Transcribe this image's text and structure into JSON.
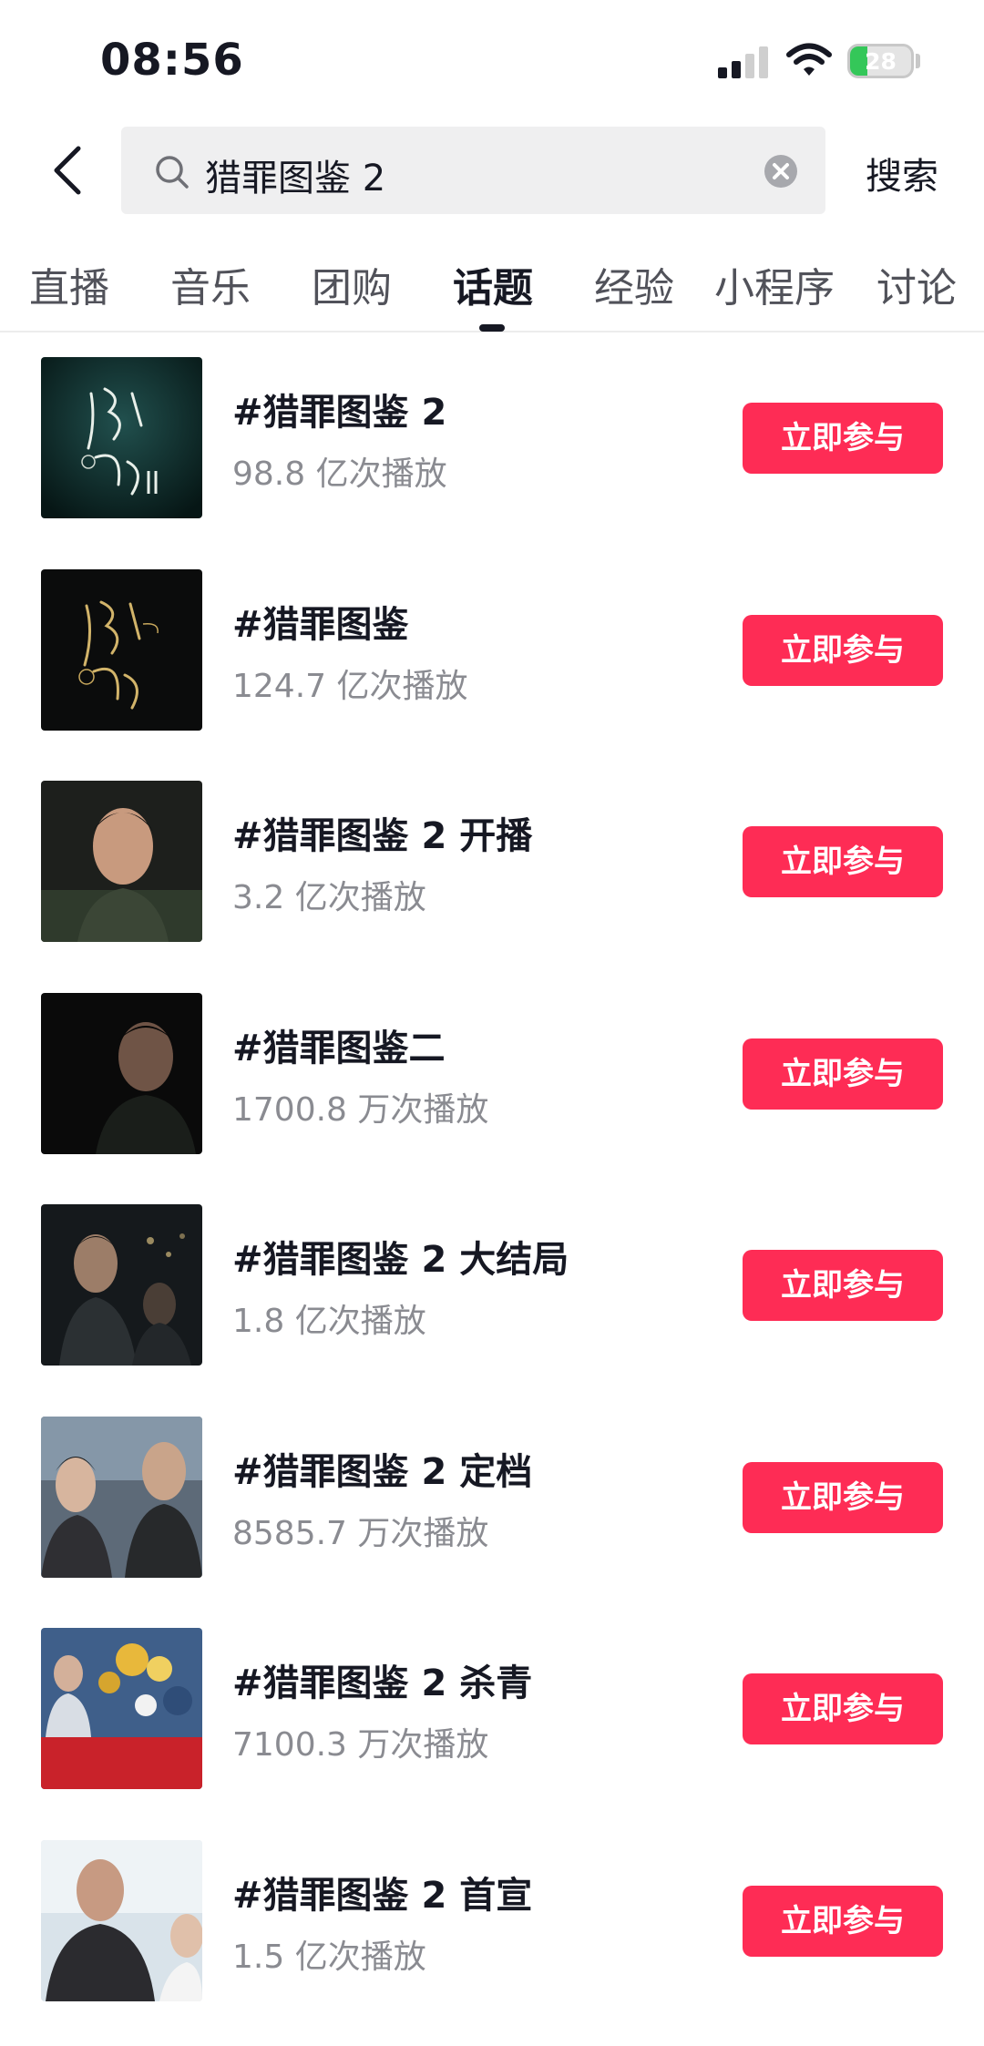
{
  "status_bar": {
    "time": "08:56",
    "battery": "28",
    "battery_level": 0.28
  },
  "search": {
    "query": "猎罪图鉴 2",
    "submit_label": "搜索"
  },
  "tabs": [
    {
      "label": "直播"
    },
    {
      "label": "音乐"
    },
    {
      "label": "团购"
    },
    {
      "label": "话题",
      "active": true
    },
    {
      "label": "经验"
    },
    {
      "label": "小程序"
    },
    {
      "label": "讨论"
    }
  ],
  "topics": [
    {
      "title": "#猎罪图鉴 2",
      "plays": "98.8 亿次播放",
      "button": "立即参与",
      "thumb": "poster-teal"
    },
    {
      "title": "#猎罪图鉴",
      "plays": "124.7 亿次播放",
      "button": "立即参与",
      "thumb": "poster-gold"
    },
    {
      "title": "#猎罪图鉴 2 开播",
      "plays": "3.2 亿次播放",
      "button": "立即参与",
      "thumb": "still-man"
    },
    {
      "title": "#猎罪图鉴二",
      "plays": "1700.8 万次播放",
      "button": "立即参与",
      "thumb": "still-dark"
    },
    {
      "title": "#猎罪图鉴 2 大结局",
      "plays": "1.8 亿次播放",
      "button": "立即参与",
      "thumb": "still-night"
    },
    {
      "title": "#猎罪图鉴 2 定档",
      "plays": "8585.7 万次播放",
      "button": "立即参与",
      "thumb": "still-two"
    },
    {
      "title": "#猎罪图鉴 2 杀青",
      "plays": "7100.3 万次播放",
      "button": "立即参与",
      "thumb": "event-flowers"
    },
    {
      "title": "#猎罪图鉴 2 首宣",
      "plays": "1.5 亿次播放",
      "button": "立即参与",
      "thumb": "still-bright"
    }
  ],
  "colors": {
    "accent": "#fe2c55",
    "text": "#161823",
    "secondary": "#8a8b91"
  }
}
